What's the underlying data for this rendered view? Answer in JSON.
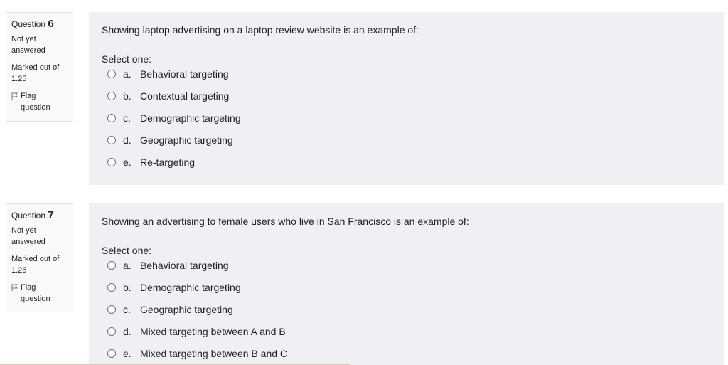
{
  "questions": [
    {
      "label": "Question",
      "number": "6",
      "state": "Not yet answered",
      "grade": "Marked out of 1.25",
      "flag": "Flag question",
      "text": "Showing laptop advertising on a laptop review website is an example of:",
      "prompt": "Select one:",
      "options": [
        {
          "letter": "a.",
          "text": "Behavioral targeting"
        },
        {
          "letter": "b.",
          "text": "Contextual targeting"
        },
        {
          "letter": "c.",
          "text": "Demographic targeting"
        },
        {
          "letter": "d.",
          "text": "Geographic targeting"
        },
        {
          "letter": "e.",
          "text": "Re-targeting"
        }
      ]
    },
    {
      "label": "Question",
      "number": "7",
      "state": "Not yet answered",
      "grade": "Marked out of 1.25",
      "flag": "Flag question",
      "text": "Showing an advertising to female users who live in San Francisco is an example of:",
      "prompt": "Select one:",
      "options": [
        {
          "letter": "a.",
          "text": "Behavioral targeting"
        },
        {
          "letter": "b.",
          "text": "Demographic targeting"
        },
        {
          "letter": "c.",
          "text": "Geographic targeting"
        },
        {
          "letter": "d.",
          "text": "Mixed targeting between A and B"
        },
        {
          "letter": "e.",
          "text": "Mixed targeting between B and C"
        }
      ]
    }
  ]
}
